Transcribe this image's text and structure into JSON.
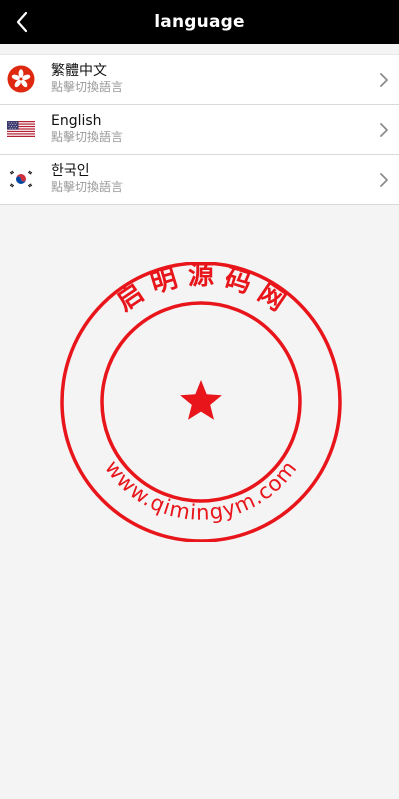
{
  "header": {
    "title": "language"
  },
  "languages": [
    {
      "name": "繁體中文",
      "subtitle": "點擊切換語言",
      "flag": "hong-kong-flag-icon"
    },
    {
      "name": "English",
      "subtitle": "點擊切換語言",
      "flag": "us-flag-icon"
    },
    {
      "name": "한국인",
      "subtitle": "點擊切換語言",
      "flag": "korea-flag-icon"
    }
  ],
  "watermark": {
    "top_text": "启 明 源 码 网",
    "bottom_text": "www.qimingym.com",
    "color": "#e8151b"
  },
  "colors": {
    "header_bg": "#000000",
    "page_bg": "#f4f4f4",
    "hk_red": "#de2910"
  }
}
